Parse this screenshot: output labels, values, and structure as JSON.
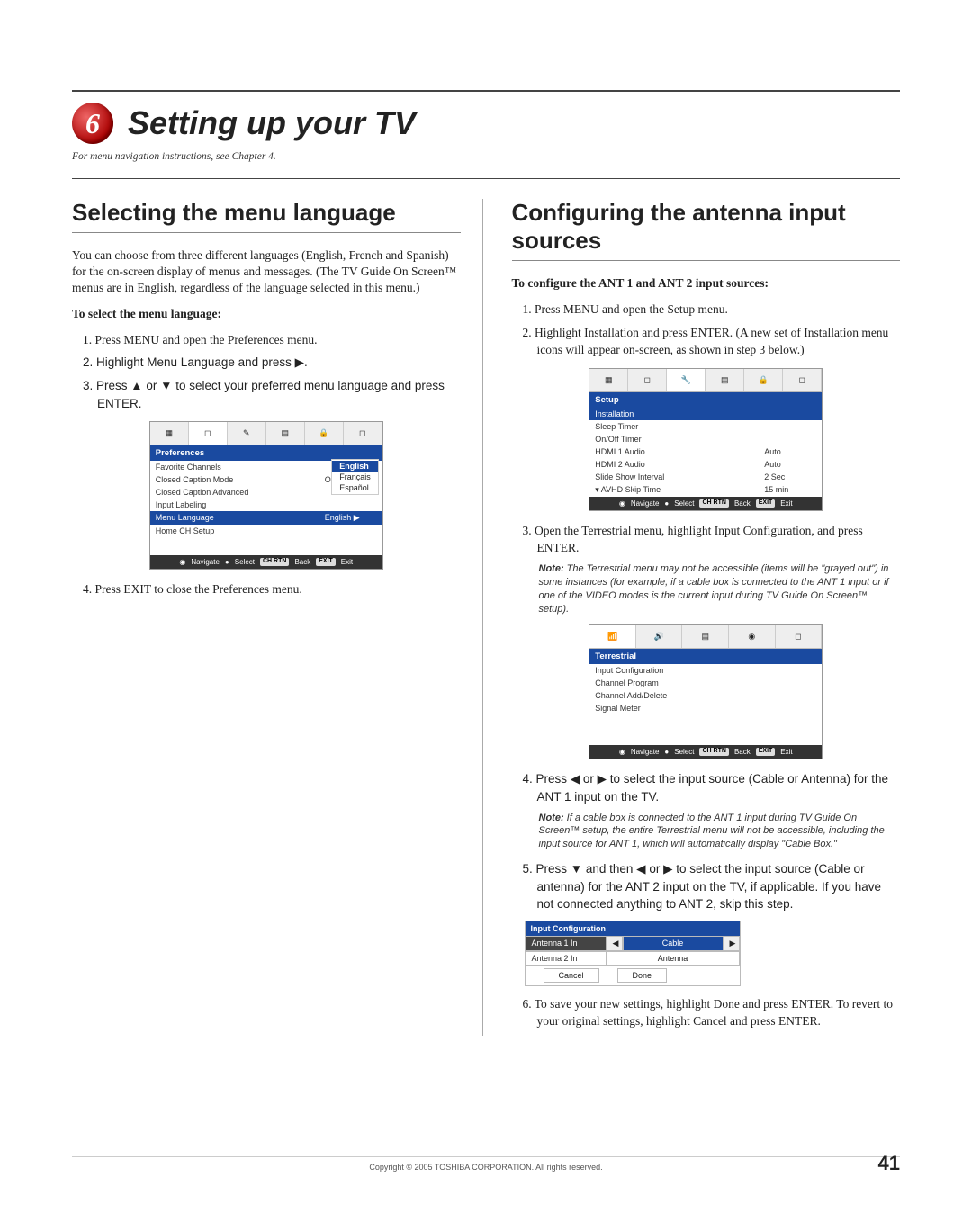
{
  "chapter": {
    "number": "6",
    "title": "Setting up your TV"
  },
  "subnote": "For menu navigation instructions, see Chapter 4.",
  "left": {
    "heading": "Selecting the menu language",
    "intro": "You can choose from three different languages (English, French and Spanish) for the on-screen display of menus and messages. (The TV Guide On Screen™ menus are in English, regardless of the language selected in this menu.)",
    "subhead": "To select the menu language:",
    "steps": [
      "1. Press MENU and open the Preferences menu.",
      "2. Highlight Menu Language and press ▶.",
      "3. Press ▲ or ▼ to select your preferred menu language and press ENTER.",
      "4. Press EXIT to close the Preferences menu."
    ],
    "osd": {
      "header": "Preferences",
      "rows": [
        {
          "label": "Favorite Channels",
          "val": ""
        },
        {
          "label": "Closed Caption Mode",
          "val": "Off"
        },
        {
          "label": "Closed Caption Advanced",
          "val": ""
        },
        {
          "label": "Input Labeling",
          "val": ""
        },
        {
          "label": "Menu Language",
          "val": "English ▶",
          "hl": true
        },
        {
          "label": "Home CH Setup",
          "val": ""
        }
      ],
      "langs": [
        "English",
        "Français",
        "Español"
      ],
      "footer": {
        "nav": "Navigate",
        "sel": "Select",
        "back": "Back",
        "exit": "Exit",
        "backKey": "CH RTN",
        "exitKey": "EXIT"
      }
    }
  },
  "right": {
    "heading": "Configuring the antenna input sources",
    "subhead": "To configure the ANT 1 and ANT 2 input sources:",
    "step1": "1. Press MENU and open the Setup menu.",
    "step2": "2. Highlight Installation and press ENTER. (A new set of Installation menu icons will appear on-screen, as shown in step 3 below.)",
    "osd_setup": {
      "header": "Setup",
      "rows": [
        {
          "label": "Installation",
          "val": "",
          "hl": true
        },
        {
          "label": "Sleep Timer",
          "val": ""
        },
        {
          "label": "On/Off Timer",
          "val": ""
        },
        {
          "label": "HDMI 1 Audio",
          "val": "Auto"
        },
        {
          "label": "HDMI 2 Audio",
          "val": "Auto"
        },
        {
          "label": "Slide Show Interval",
          "val": "2 Sec"
        },
        {
          "label": "AVHD Skip Time",
          "val": "15 min"
        }
      ]
    },
    "step3": "3. Open the Terrestrial menu, highlight Input Configuration, and press ENTER.",
    "note1_label": "Note:",
    "note1": " The Terrestrial menu may not be accessible (items will be \"grayed out\") in some instances (for example, if a cable box is connected to the ANT 1 input or if one of the VIDEO modes is the current input during TV Guide On Screen™ setup).",
    "osd_terr": {
      "header": "Terrestrial",
      "rows": [
        {
          "label": "Input Configuration"
        },
        {
          "label": "Channel Program"
        },
        {
          "label": "Channel Add/Delete"
        },
        {
          "label": "Signal Meter"
        }
      ]
    },
    "step4": "4. Press ◀ or ▶ to select the input source (Cable or Antenna) for the ANT 1 input on the TV.",
    "note2_label": "Note:",
    "note2": " If a cable box is connected to the ANT 1 input during TV Guide On Screen™ setup, the entire Terrestrial menu will not be accessible, including the input source for ANT 1, which will automatically display \"Cable Box.\"",
    "step5": "5. Press ▼ and then ◀ or ▶ to select the input source (Cable or antenna) for the ANT 2 input on the TV, if applicable. If you have not connected anything to ANT 2, skip this step.",
    "input_config": {
      "header": "Input Configuration",
      "row1_label": "Antenna 1 In",
      "row1_val": "Cable",
      "row2_label": "Antenna 2 In",
      "row2_val": "Antenna",
      "cancel": "Cancel",
      "done": "Done"
    },
    "step6": "6. To save your new settings, highlight Done and press ENTER. To revert to your original settings, highlight Cancel and press ENTER."
  },
  "footer": {
    "copyright": "Copyright © 2005 TOSHIBA CORPORATION. All rights reserved.",
    "page": "41"
  }
}
